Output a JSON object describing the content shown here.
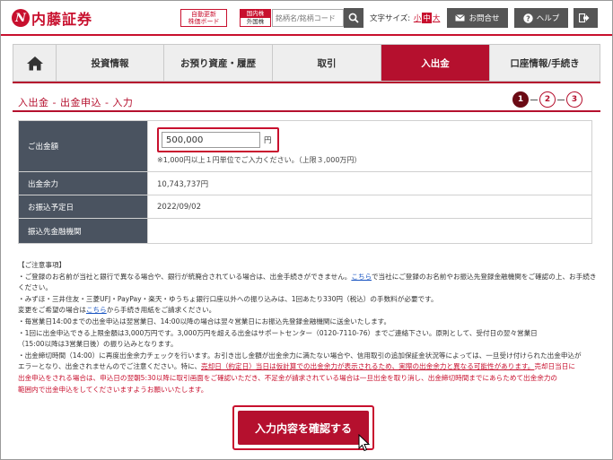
{
  "header": {
    "logo_mark": "N",
    "logo_text": "内藤証券",
    "auto_update_line1": "自動更新",
    "auto_update_line2": "株価ボード",
    "market_top": "国内株",
    "market_bottom": "外国株",
    "search_placeholder": "銘柄名/銘柄コード",
    "font_size_label": "文字サイズ:",
    "font_sizes": [
      "小",
      "中",
      "大"
    ],
    "font_size_selected": "中",
    "contact_label": "お問合せ",
    "help_label": "ヘルプ",
    "logout_icon": "logout-icon"
  },
  "nav": {
    "items": [
      "投資情報",
      "お預り資産・履歴",
      "取引",
      "入出金",
      "口座情報/手続き"
    ],
    "active": "入出金"
  },
  "page": {
    "title": "入出金 - 出金申込 - 入力",
    "steps": [
      "1",
      "2",
      "3"
    ],
    "current_step": "1"
  },
  "form": {
    "amount_label": "ご出金額",
    "amount_value": "500,000",
    "amount_unit": "円",
    "amount_note": "※1,000円以上１円単位でご入力ください。（上限３,000万円）",
    "balance_label": "出金余力",
    "balance_value": "10,743,737円",
    "transfer_date_label": "お振込予定日",
    "transfer_date_value": "2022/09/02",
    "bank_label": "振込先金融機関",
    "bank_value": ""
  },
  "notes": {
    "heading": "【ご注意事項】",
    "n1a": "・ご登録のお名前が当社と銀行で異なる場合や、銀行が統廃合されている場合は、出金手続きができません。",
    "n1link": "こちら",
    "n1b": "で当社にご登録のお名前やお振込先登録金融機関をご確認の上、お手続きください。",
    "n2": "・みずほ・三井住友・三菱UFJ・PayPay・楽天・ゆうちょ銀行口座以外への振り込みは、1回あたり330円（税込）の手数料が必要です。",
    "n3a": "変更をご希望の場合は",
    "n3link": "こちら",
    "n3b": "から手続き用紙をご請求ください。",
    "n4": "・毎営業日14:00までの出金申込は翌営業日、14:00以降の場合は翌々営業日にお振込先登録金融機関に送金いたします。",
    "n5": "・1回に出金申込できる上限金額は3,000万円です。3,000万円を超える出金はサポートセンター（0120-7110-76）までご連絡下さい。原則として、受付日の翌々営業日",
    "n5b": "（15:00以降は3営業日後）の振り込みとなります。",
    "n6": "・出金締切時間（14:00）に再度出金余力チェックを行います。お引き出し金額が出金余力に満たない場合や、信用取引の追加保証金状況等によっては、一旦受け付けられた出金申込が",
    "n6b": "エラーとなり、出金されませんのでご注意ください。特に、",
    "n6c": "売却日（約定日）当日は仮計算での出金余力が表示されるため、実際の出金余力と異なる可能性があります。",
    "n6d": "売却日当日に",
    "n7": "出金申込をされる場合は、申込日の翌朝5:30以降に取引画面をご確認いただき、不足金が請求されている場合は一旦出金を取り消し、出金締切時間までにあらためて出金余力の",
    "n8": "範囲内で出金申込をしてくださいますようお願いいたします。"
  },
  "confirm_label": "入力内容を確認する",
  "colors": {
    "brand_red": "#c8102e",
    "nav_active": "#b5102e",
    "table_header": "#4a5360"
  }
}
